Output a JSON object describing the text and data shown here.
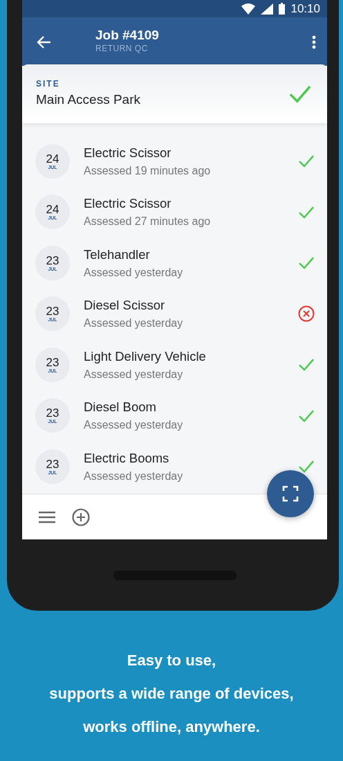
{
  "status_bar": {
    "time": "10:10"
  },
  "app_bar": {
    "title": "Job #4109",
    "subtitle": "RETURN QC"
  },
  "site": {
    "label": "SITE",
    "name": "Main Access Park",
    "passed": true
  },
  "assessments": [
    {
      "day": "24",
      "month": "JUL",
      "title": "Electric Scissor",
      "subtitle": "Assessed 19 minutes ago",
      "passed": true
    },
    {
      "day": "24",
      "month": "JUL",
      "title": "Electric Scissor",
      "subtitle": "Assessed 27 minutes ago",
      "passed": true
    },
    {
      "day": "23",
      "month": "JUL",
      "title": "Telehandler",
      "subtitle": "Assessed yesterday",
      "passed": true
    },
    {
      "day": "23",
      "month": "JUL",
      "title": "Diesel Scissor",
      "subtitle": "Assessed yesterday",
      "passed": false
    },
    {
      "day": "23",
      "month": "JUL",
      "title": "Light Delivery Vehicle",
      "subtitle": "Assessed yesterday",
      "passed": true
    },
    {
      "day": "23",
      "month": "JUL",
      "title": "Diesel Boom",
      "subtitle": "Assessed yesterday",
      "passed": true
    },
    {
      "day": "23",
      "month": "JUL",
      "title": "Electric Booms",
      "subtitle": "Assessed yesterday",
      "passed": true
    }
  ],
  "tagline": [
    "Easy to use,",
    "supports a wide range of devices,",
    "works offline, anywhere."
  ]
}
